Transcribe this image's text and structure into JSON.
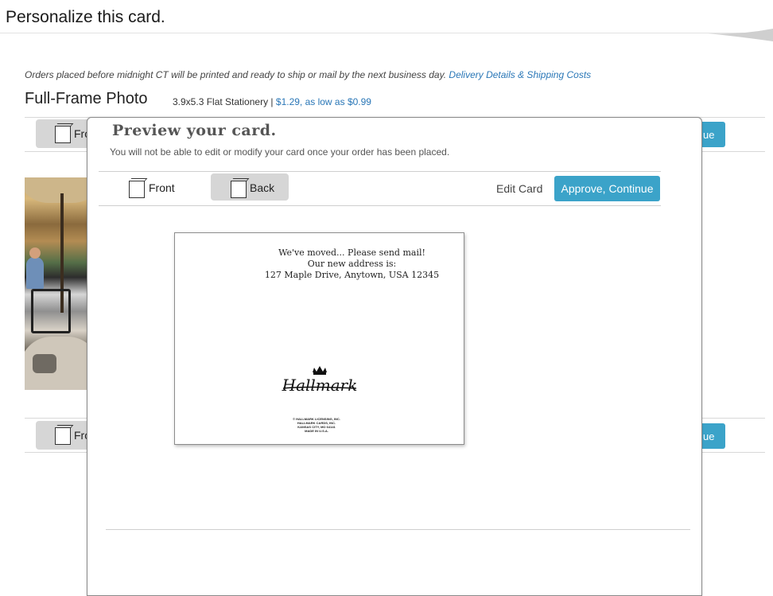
{
  "page": {
    "title": "Personalize this card.",
    "notice_text": "Orders placed before midnight CT will be printed and ready to ship or mail by the next business day.",
    "notice_link": "Delivery Details & Shipping Costs",
    "product_name": "Full-Frame Photo",
    "product_size": "3.9x5.3 Flat Stationery",
    "product_separator": "|",
    "product_price": "$1.29, as low as $0.99",
    "bg_tab_label_top": "Fro",
    "bg_tab_label_bottom": "Fro",
    "bg_btn_label_top": "ue",
    "bg_btn_label_bottom": "ue"
  },
  "modal": {
    "title": "Preview your card.",
    "subtitle": "You will not be able to edit or modify your card once your order has been placed.",
    "tabs": [
      {
        "label": "Front",
        "active": false
      },
      {
        "label": "Back",
        "active": true
      }
    ],
    "edit_label": "Edit Card",
    "approve_label": "Approve, Continue"
  },
  "card": {
    "message_lines": [
      "We've moved... Please send mail!",
      "Our new address is:",
      "127 Maple Drive, Anytown, USA 12345"
    ],
    "logo_text": "Hallmark",
    "copyright_lines": [
      "© HALLMARK LICENSING, INC.",
      "HALLMARK CARDS, INC.",
      "KANSAS CITY, MO 64141",
      "MADE IN U.S.A."
    ]
  },
  "colors": {
    "accent": "#3ba3c9",
    "link": "#2a77b7"
  }
}
